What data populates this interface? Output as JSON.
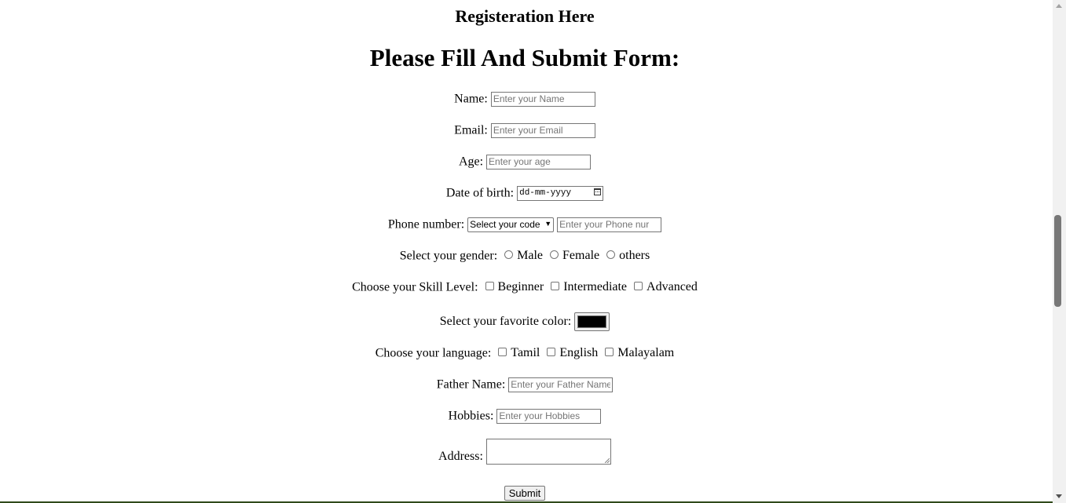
{
  "page": {
    "title": "Registeration Here",
    "heading": "Please Fill And Submit Form:"
  },
  "form": {
    "name": {
      "label": "Name:",
      "placeholder": "Enter your Name"
    },
    "email": {
      "label": "Email:",
      "placeholder": "Enter your Email"
    },
    "age": {
      "label": "Age:",
      "placeholder": "Enter your age"
    },
    "dob": {
      "label": "Date of birth:",
      "placeholder": "dd-mm-yyyy",
      "icon": "calendar-icon"
    },
    "phone": {
      "label": "Phone number:",
      "select_value": "Select your code",
      "placeholder": "Enter your Phone nur"
    },
    "gender": {
      "label": "Select your gender:",
      "options": [
        "Male",
        "Female",
        "others"
      ]
    },
    "skill": {
      "label": "Choose your Skill Level:",
      "options": [
        "Beginner",
        "Intermediate",
        "Advanced"
      ]
    },
    "color": {
      "label": "Select your favorite color:",
      "value": "#000000"
    },
    "language": {
      "label": "Choose your language:",
      "options": [
        "Tamil",
        "English",
        "Malayalam"
      ]
    },
    "father": {
      "label": "Father Name:",
      "placeholder": "Enter your Father Name"
    },
    "hobbies": {
      "label": "Hobbies:",
      "placeholder": "Enter your Hobbies"
    },
    "address": {
      "label": "Address:"
    },
    "submit_label": "Submit"
  },
  "colors": {
    "page_background": "#ffffff",
    "window_border": "#2f4a1a",
    "scroll_thumb": "#787878"
  }
}
